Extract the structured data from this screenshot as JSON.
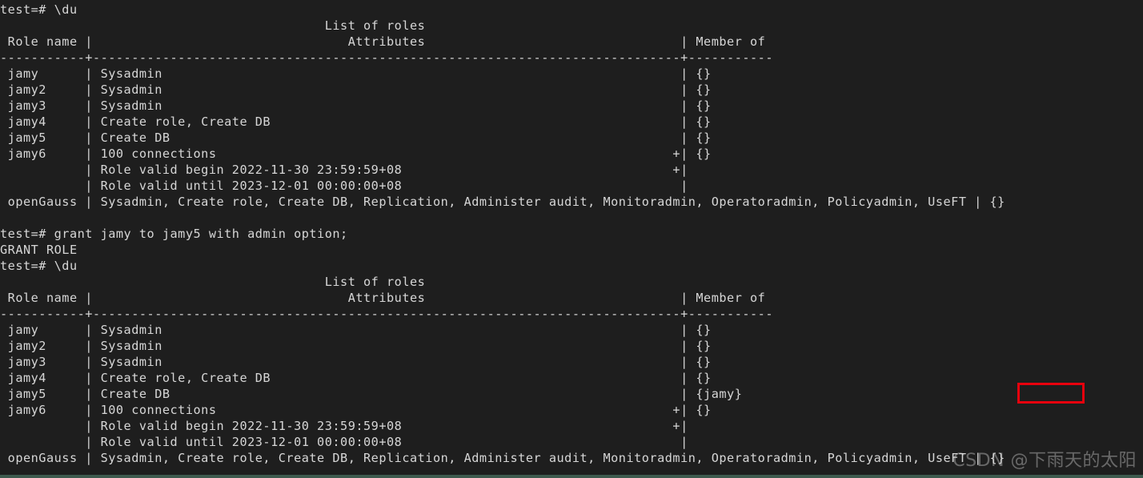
{
  "terminal": {
    "prompt": "test=#",
    "colors": {
      "background": "#1e1e1e",
      "foreground": "#d6d6d6",
      "highlight_box": "#e8000d",
      "bottom_border": "#3e5a4e"
    },
    "watermark": "CSDN @下雨天的太阳",
    "lines": [
      "test=# \\du",
      "                                          List of roles",
      " Role name |                                 Attributes                                 | Member of",
      "-----------+----------------------------------------------------------------------------+-----------",
      " jamy      | Sysadmin                                                                   | {}",
      " jamy2     | Sysadmin                                                                   | {}",
      " jamy3     | Sysadmin                                                                   | {}",
      " jamy4     | Create role, Create DB                                                     | {}",
      " jamy5     | Create DB                                                                  | {}",
      " jamy6     | 100 connections                                                           +| {}",
      "           | Role valid begin 2022-11-30 23:59:59+08                                   +|",
      "           | Role valid until 2023-12-01 00:00:00+08                                    |",
      " openGauss | Sysadmin, Create role, Create DB, Replication, Administer audit, Monitoradmin, Operatoradmin, Policyadmin, UseFT | {}",
      "",
      "test=# grant jamy to jamy5 with admin option;",
      "GRANT ROLE",
      "test=# \\du",
      "                                          List of roles",
      " Role name |                                 Attributes                                 | Member of",
      "-----------+----------------------------------------------------------------------------+-----------",
      " jamy      | Sysadmin                                                                   | {}",
      " jamy2     | Sysadmin                                                                   | {}",
      " jamy3     | Sysadmin                                                                   | {}",
      " jamy4     | Create role, Create DB                                                     | {}",
      " jamy5     | Create DB                                                                  | {jamy}",
      " jamy6     | 100 connections                                                           +| {}",
      "           | Role valid begin 2022-11-30 23:59:59+08                                   +|",
      "           | Role valid until 2023-12-01 00:00:00+08                                    |",
      " openGauss | Sysadmin, Create role, Create DB, Replication, Administer audit, Monitoradmin, Operatoradmin, Policyadmin, UseFT | {}"
    ],
    "commands": [
      {
        "index": 0,
        "text": "\\du",
        "description": "list-roles"
      },
      {
        "index": 14,
        "text": "grant jamy to jamy5 with admin option;",
        "description": "grant-role"
      },
      {
        "index": 16,
        "text": "\\du",
        "description": "list-roles"
      }
    ],
    "result_messages": [
      {
        "index": 15,
        "text": "GRANT ROLE"
      }
    ],
    "table_title": "List of roles",
    "columns": [
      "Role name",
      "Attributes",
      "Member of"
    ],
    "roles_before": [
      {
        "role_name": "jamy",
        "attributes": "Sysadmin",
        "member_of": "{}"
      },
      {
        "role_name": "jamy2",
        "attributes": "Sysadmin",
        "member_of": "{}"
      },
      {
        "role_name": "jamy3",
        "attributes": "Sysadmin",
        "member_of": "{}"
      },
      {
        "role_name": "jamy4",
        "attributes": "Create role, Create DB",
        "member_of": "{}"
      },
      {
        "role_name": "jamy5",
        "attributes": "Create DB",
        "member_of": "{}"
      },
      {
        "role_name": "jamy6",
        "attributes": "100 connections\nRole valid begin 2022-11-30 23:59:59+08\nRole valid until 2023-12-01 00:00:00+08",
        "member_of": "{}"
      },
      {
        "role_name": "openGauss",
        "attributes": "Sysadmin, Create role, Create DB, Replication, Administer audit, Monitoradmin, Operatoradmin, Policyadmin, UseFT",
        "member_of": "{}"
      }
    ],
    "roles_after": [
      {
        "role_name": "jamy",
        "attributes": "Sysadmin",
        "member_of": "{}"
      },
      {
        "role_name": "jamy2",
        "attributes": "Sysadmin",
        "member_of": "{}"
      },
      {
        "role_name": "jamy3",
        "attributes": "Sysadmin",
        "member_of": "{}"
      },
      {
        "role_name": "jamy4",
        "attributes": "Create role, Create DB",
        "member_of": "{}"
      },
      {
        "role_name": "jamy5",
        "attributes": "Create DB",
        "member_of": "{jamy}"
      },
      {
        "role_name": "jamy6",
        "attributes": "100 connections\nRole valid begin 2022-11-30 23:59:59+08\nRole valid until 2023-12-01 00:00:00+08",
        "member_of": "{}"
      },
      {
        "role_name": "openGauss",
        "attributes": "Sysadmin, Create role, Create DB, Replication, Administer audit, Monitoradmin, Operatoradmin, Policyadmin, UseFT",
        "member_of": "{}"
      }
    ],
    "highlighted_value": "{jamy}"
  }
}
